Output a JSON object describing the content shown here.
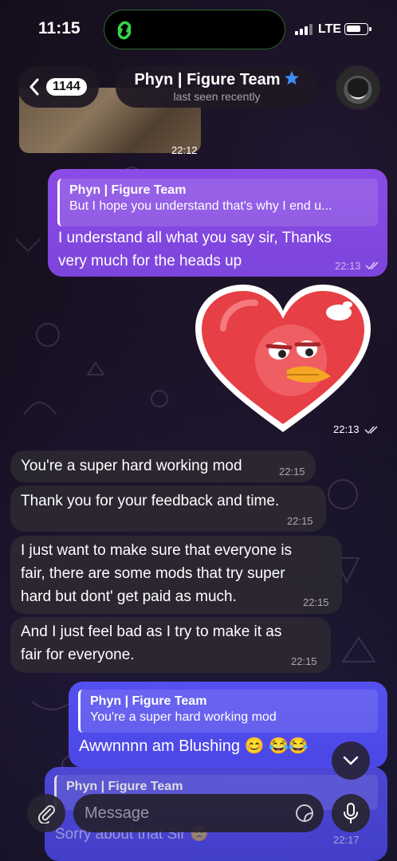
{
  "status_bar": {
    "time": "11:15",
    "network": "LTE"
  },
  "header": {
    "back_count": "1144",
    "title": "Phyn | Figure Team",
    "subtitle": "last seen recently"
  },
  "photo": {
    "time": "22:12"
  },
  "messages": [
    {
      "reply_name": "Phyn | Figure Team",
      "reply_text": "But I hope you understand that's why I end u...",
      "line1": "I understand all what you say sir, Thanks",
      "line2": "very much for the heads up",
      "time": "22:13"
    },
    {
      "type": "sticker",
      "time": "22:13"
    },
    {
      "text": "You're a super hard working mod",
      "time": "22:15"
    },
    {
      "text": "Thank you for your feedback and time.",
      "time": "22:15"
    },
    {
      "line1": "I just want to make sure that everyone is",
      "line2": "fair, there are some mods that try super",
      "line3": "hard but dont' get paid as much.",
      "time": "22:15"
    },
    {
      "line1": "And I just feel bad as I try to make it as",
      "line2": "fair for everyone.",
      "time": "22:15"
    },
    {
      "reply_name": "Phyn | Figure Team",
      "reply_text": "You're a super hard working mod",
      "text": "Awwnnnn am Blushing 😊 😂😂"
    },
    {
      "reply_name": "Phyn | Figure Team",
      "text": "Sorry about that Sir 🙁",
      "time": "22:17"
    }
  ],
  "composer": {
    "placeholder": "Message"
  },
  "colors": {
    "outgoing_purple": "#8b4be6",
    "outgoing_blue": "#5550f0",
    "incoming": "#2c2832"
  }
}
